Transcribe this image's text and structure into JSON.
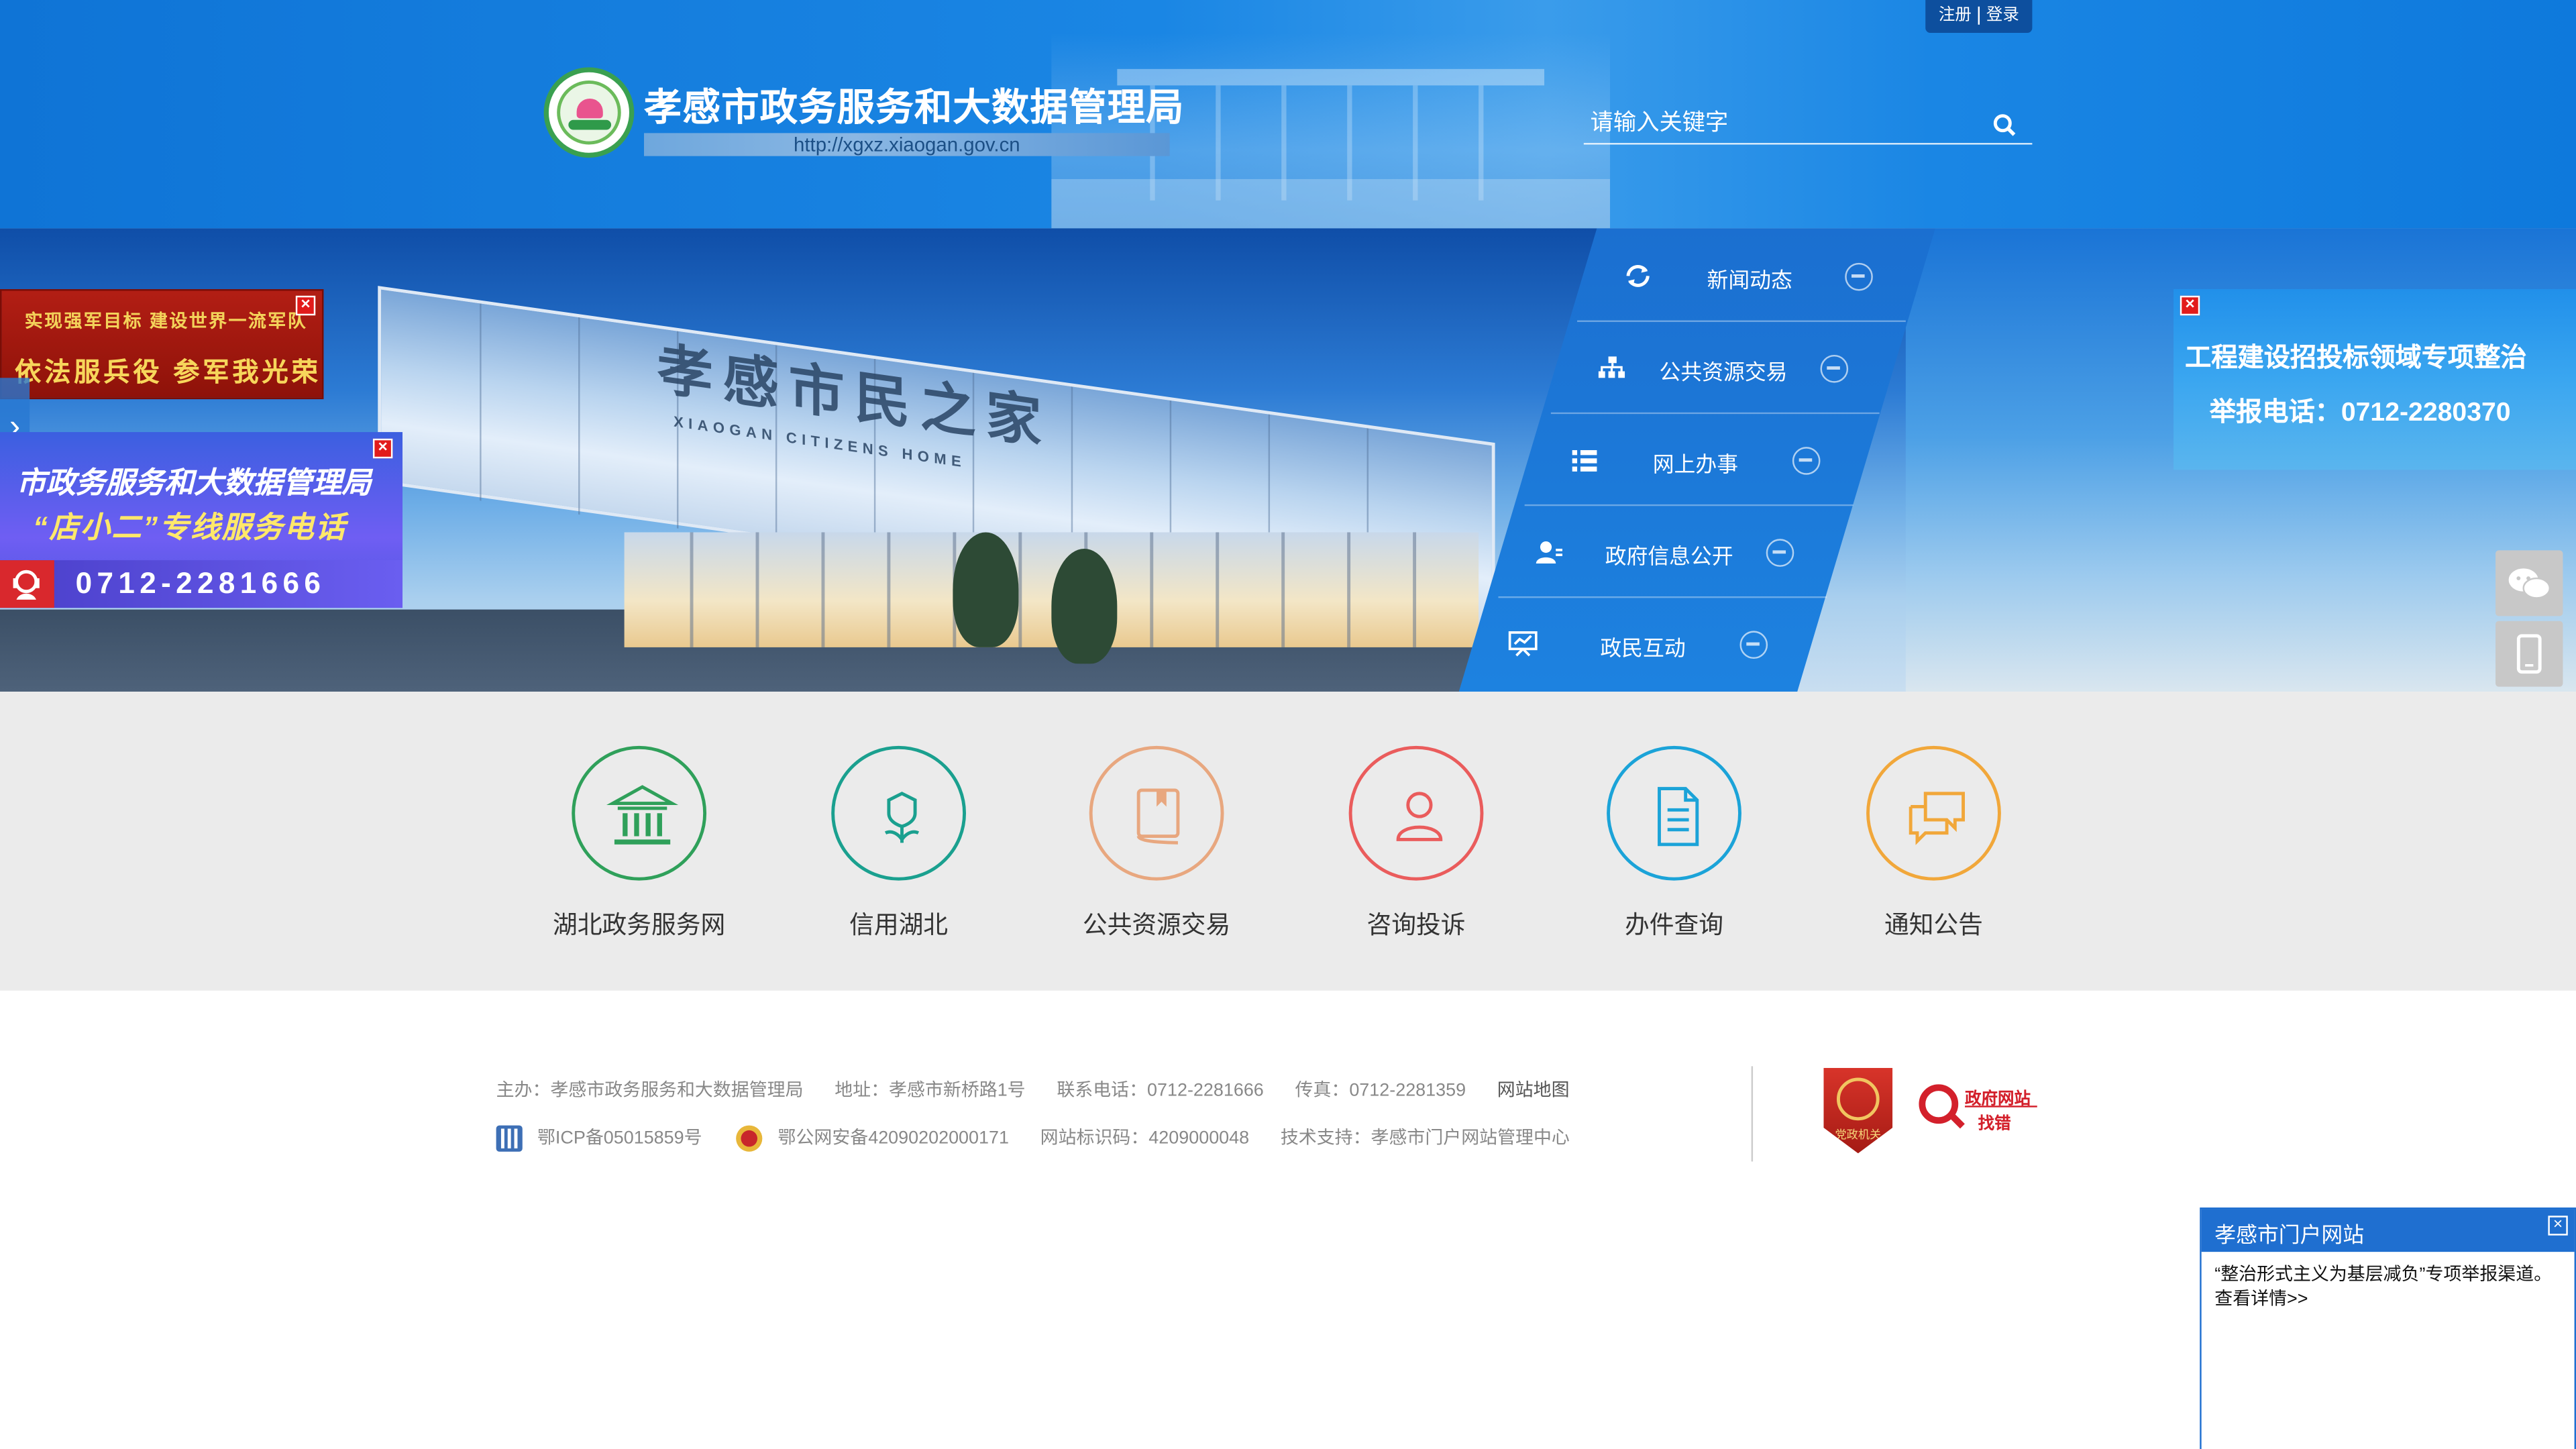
{
  "header": {
    "site_title": "孝感市政务服务和大数据管理局",
    "site_url": "http://xgxz.xiaogan.gov.cn",
    "auth": {
      "register": "注册",
      "login": "登录"
    },
    "search": {
      "placeholder": "请输入关键字"
    },
    "logo_icon": "government-emblem-logo"
  },
  "banner": {
    "building_sign": "孝感市民之家",
    "building_sign_en": "XIAOGAN CITIZENS HOME"
  },
  "nav": [
    {
      "label": "新闻动态",
      "icon": "refresh-icon"
    },
    {
      "label": "公共资源交易",
      "icon": "org-chart-icon"
    },
    {
      "label": "网上办事",
      "icon": "list-icon"
    },
    {
      "label": "政府信息公开",
      "icon": "user-info-icon"
    },
    {
      "label": "政民互动",
      "icon": "presentation-icon"
    }
  ],
  "ads": {
    "army": {
      "line1": "实现强军目标 建设世界一流军队",
      "line2": "依法服兵役 参军我光荣"
    },
    "service": {
      "line1": "市政务服务和大数据管理局",
      "line2": "“店小二”专线服务电话",
      "phone": "0712-2281666"
    },
    "report": {
      "line1": "工程建设招投标领域专项整治",
      "line2": "举报电话：0712-2280370"
    }
  },
  "quick_links": [
    {
      "label": "湖北政务服务网",
      "icon": "building-icon",
      "color": "#2fa05a"
    },
    {
      "label": "信用湖北",
      "icon": "flower-icon",
      "color": "#1aa08f"
    },
    {
      "label": "公共资源交易",
      "icon": "book-icon",
      "color": "#e8a77f"
    },
    {
      "label": "咨询投诉",
      "icon": "person-icon",
      "color": "#ea5c5c"
    },
    {
      "label": "办件查询",
      "icon": "document-icon",
      "color": "#1ba3d8"
    },
    {
      "label": "通知公告",
      "icon": "chat-icon",
      "color": "#f1a73a"
    }
  ],
  "footer": {
    "host": "主办：孝感市政务服务和大数据管理局",
    "address": "地址：孝感市新桥路1号",
    "phone": "联系电话：0712-2281666",
    "fax": "传真：0712-2281359",
    "sitemap": "网站地图",
    "icp": "鄂ICP备05015859号",
    "police": "鄂公网安备42090202000171",
    "site_id": "网站标识码：4209000048",
    "tech": "技术支持：孝感市门户网站管理中心",
    "badge_party": "党政机关",
    "badge_error_1": "政府网站",
    "badge_error_2": "找错"
  },
  "popup": {
    "title": "孝感市门户网站",
    "body": "“整治形式主义为基层减负”专项举报渠道。查看详情>>"
  },
  "colors": {
    "header_blue": "#1a86e4",
    "nav_blue": "#1d82e0",
    "quick_bg": "#ebebeb",
    "popup_blue": "#1f6fd0"
  }
}
